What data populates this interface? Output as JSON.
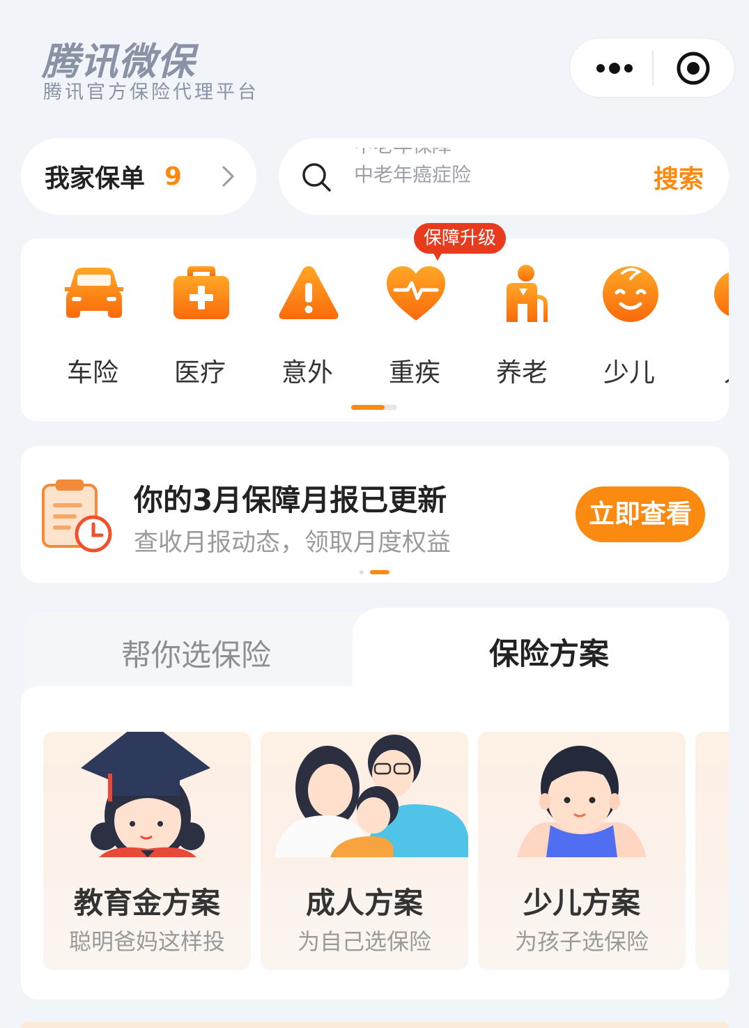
{
  "header": {
    "brand_title": "腾讯微保",
    "brand_subtitle": "腾讯官方保险代理平台",
    "capsule_icons": [
      "more-icon",
      "target-icon"
    ]
  },
  "policy": {
    "label": "我家保单",
    "count": "9"
  },
  "search": {
    "rotating_placeholder_1": "中老年保障",
    "rotating_placeholder_2": "中老年癌症险",
    "button_label": "搜索"
  },
  "categories": {
    "badge": "保障升级",
    "items": [
      {
        "label": "车险",
        "icon": "car-icon"
      },
      {
        "label": "医疗",
        "icon": "medical-kit-icon"
      },
      {
        "label": "意外",
        "icon": "warning-icon"
      },
      {
        "label": "重疾",
        "icon": "heart-pulse-icon"
      },
      {
        "label": "养老",
        "icon": "elderly-icon"
      },
      {
        "label": "少儿",
        "icon": "baby-icon"
      },
      {
        "label": "人",
        "icon": "person-icon"
      }
    ]
  },
  "report": {
    "title": "你的3月保障月报已更新",
    "subtitle": "查收月报动态，领取月度权益",
    "button_label": "立即查看"
  },
  "tabs": [
    {
      "label": "帮你选保险",
      "active": false
    },
    {
      "label": "保险方案",
      "active": true
    }
  ],
  "plans": [
    {
      "title": "教育金方案",
      "subtitle": "聪明爸妈这样投"
    },
    {
      "title": "成人方案",
      "subtitle": "为自己选保险"
    },
    {
      "title": "少儿方案",
      "subtitle": "为孩子选保险"
    }
  ],
  "colors": {
    "accent": "#fa8a10",
    "badge_red": "#e83a1c",
    "page_bg": "#f1f4f9"
  }
}
